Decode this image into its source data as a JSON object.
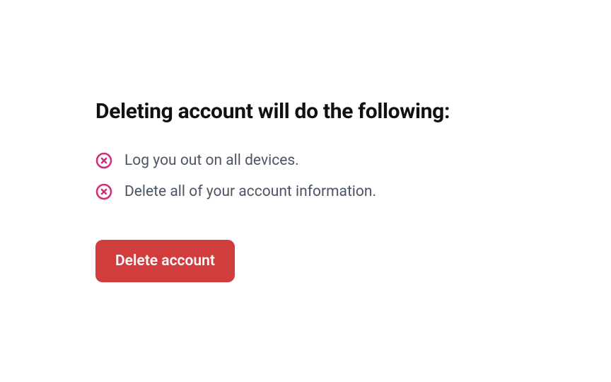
{
  "heading": "Deleting account will do the following:",
  "consequences": [
    "Log you out on all devices.",
    "Delete all of your account information."
  ],
  "button_label": "Delete account",
  "colors": {
    "icon": "#db2777",
    "button": "#d13c3c"
  }
}
